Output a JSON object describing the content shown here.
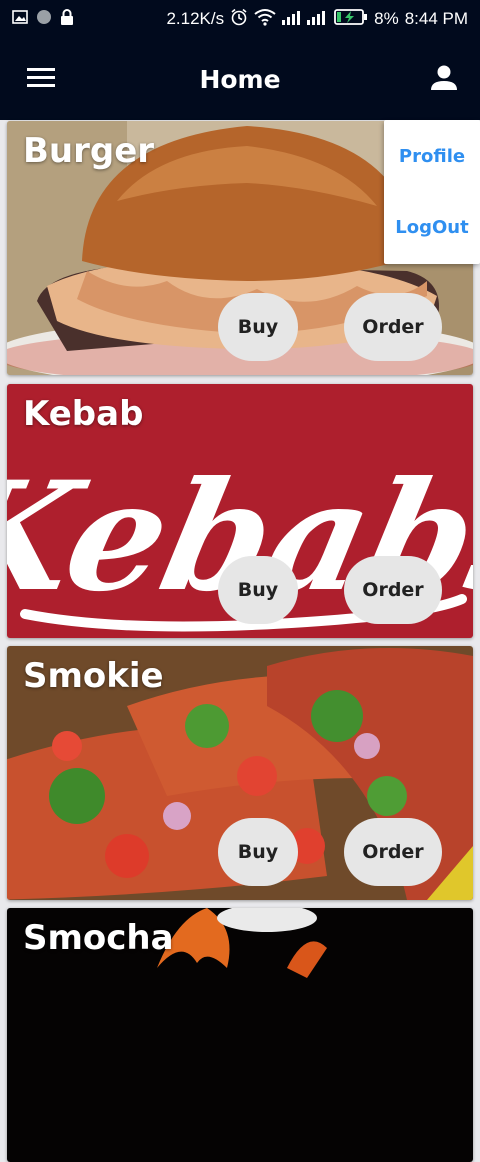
{
  "status_bar": {
    "network_speed": "2.12K/s",
    "battery": "8%",
    "time": "8:44 PM",
    "icons": [
      "image-icon",
      "circle-icon",
      "lock-icon",
      "alarm-icon",
      "wifi-icon",
      "signal-icon",
      "battery-charging-icon"
    ]
  },
  "appbar": {
    "title": "Home",
    "menu_icon": "hamburger-menu-icon",
    "account_icon": "person-icon"
  },
  "dropdown_menu": {
    "items": [
      {
        "label": "Profile"
      },
      {
        "label": "LogOut"
      }
    ]
  },
  "cards": [
    {
      "name": "Burger",
      "buy_label": "Buy",
      "order_label": "Order"
    },
    {
      "name": "Kebab",
      "buy_label": "Buy",
      "order_label": "Order",
      "logo_text": "Kebabs"
    },
    {
      "name": "Smokie",
      "buy_label": "Buy",
      "order_label": "Order"
    },
    {
      "name": "Smocha"
    }
  ],
  "colors": {
    "appbar_bg": "#010a1d",
    "menu_text": "#2f8ff0",
    "kebab_bg": "#b3202f",
    "pill_bg": "#e6e6e6"
  }
}
